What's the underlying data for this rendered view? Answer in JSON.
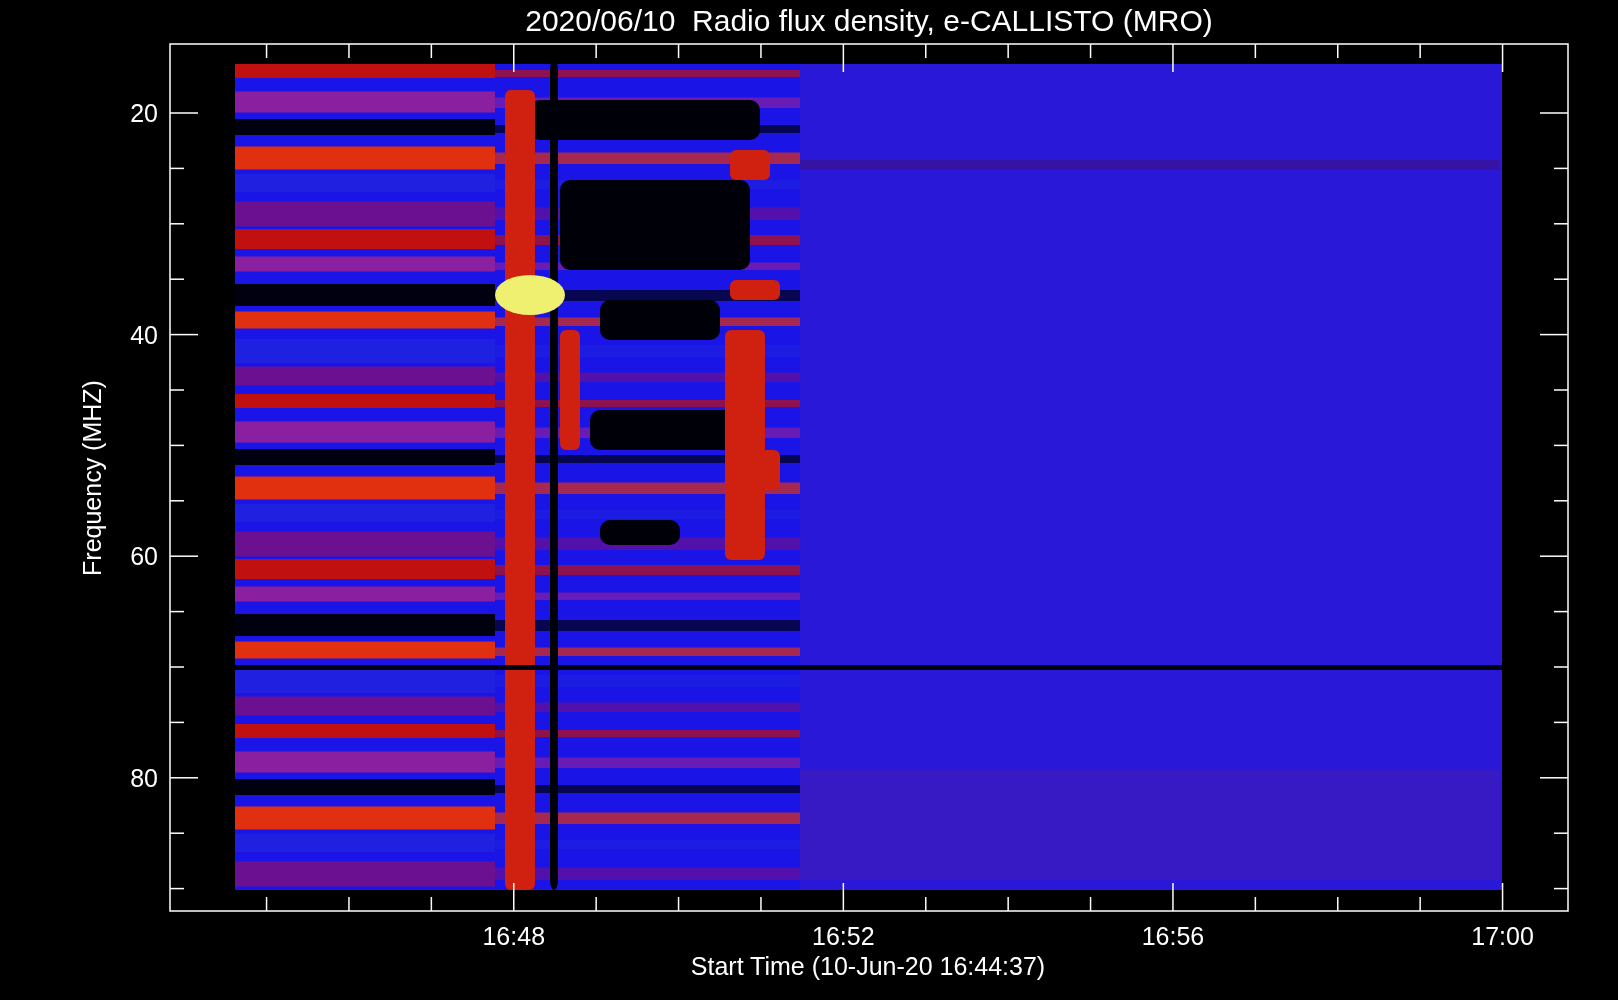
{
  "title": "2020/06/10  Radio flux density, e-CALLISTO (MRO)",
  "y_axis": {
    "label": "Frequency (MHZ)",
    "ticks": [
      "20",
      "40",
      "60",
      "80"
    ]
  },
  "x_axis": {
    "label": "Start Time (10-Jun-20 16:44:37)",
    "ticks": [
      "16:48",
      "16:52",
      "16:56",
      "17:00"
    ]
  }
}
